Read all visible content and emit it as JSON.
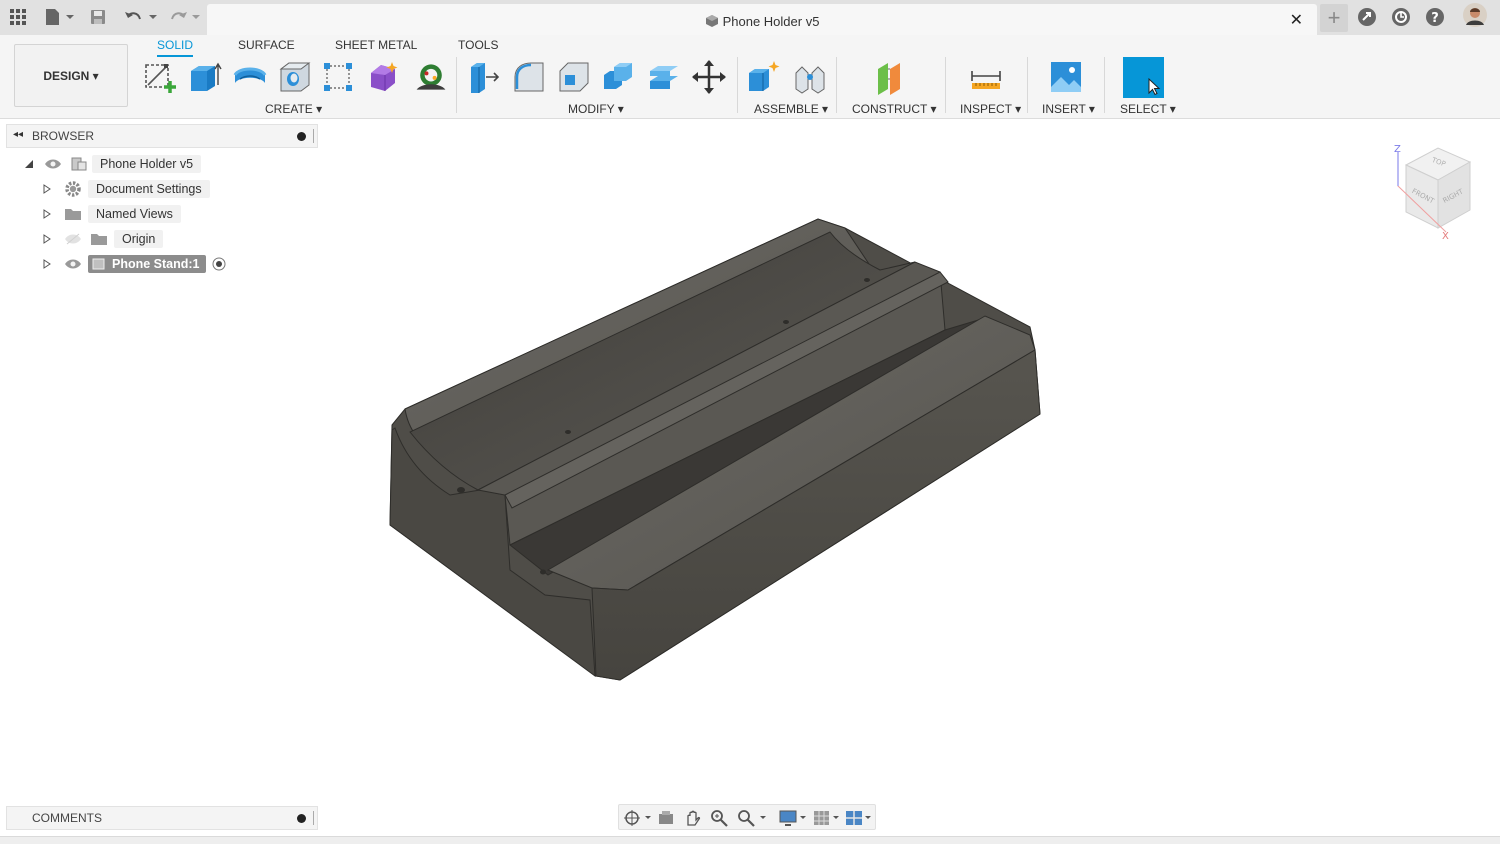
{
  "titlebar": {
    "document_title": "Phone Holder v5",
    "close_tab": "✕",
    "new_tab": "+"
  },
  "ribbon": {
    "workspace": "DESIGN ▾",
    "tabs": [
      "SOLID",
      "SURFACE",
      "SHEET METAL",
      "TOOLS"
    ],
    "active_tab": "SOLID",
    "groups": {
      "create": "CREATE ▾",
      "modify": "MODIFY ▾",
      "assemble": "ASSEMBLE ▾",
      "construct": "CONSTRUCT ▾",
      "inspect": "INSPECT ▾",
      "insert": "INSERT ▾",
      "select": "SELECT ▾"
    }
  },
  "browser": {
    "title": "BROWSER",
    "items": [
      {
        "label": "Phone Holder v5"
      },
      {
        "label": "Document Settings"
      },
      {
        "label": "Named Views"
      },
      {
        "label": "Origin"
      },
      {
        "label": "Phone Stand:1"
      }
    ]
  },
  "viewcube": {
    "top": "TOP",
    "front": "FRONT",
    "right": "RIGHT",
    "axis_z": "Z",
    "axis_x": "X"
  },
  "comments": {
    "title": "COMMENTS"
  },
  "colors": {
    "accent": "#0696d7",
    "model": "#5a5853",
    "select_tool": "#0696d7"
  }
}
